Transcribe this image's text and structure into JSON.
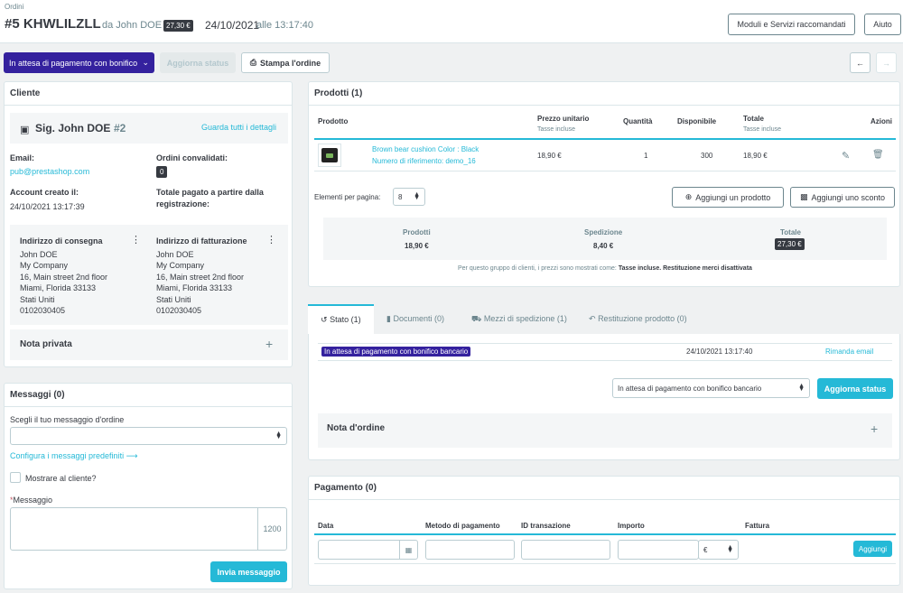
{
  "breadcrumb": "Ordini",
  "header": {
    "number": "#5",
    "reference": "KHWLILZLL",
    "by": "da John DOE",
    "total_badge": "27,30 €",
    "date": "24/10/2021",
    "at": "alle 13:17:40",
    "btn_modules": "Moduli e Servizi raccomandati",
    "btn_help": "Aiuto"
  },
  "toolbar": {
    "status": "In attesa di pagamento con bonifico",
    "update": "Aggiorna status",
    "print": "Stampa l'ordine"
  },
  "customer": {
    "title": "Cliente",
    "name": "Sig. John DOE",
    "id": "#2",
    "see_all": "Guarda tutti i dettagli",
    "email_label": "Email:",
    "email": "pub@prestashop.com",
    "orders_label": "Ordini convalidati:",
    "orders_count": "0",
    "created_label": "Account creato il:",
    "created": "24/10/2021 13:17:39",
    "total_label_1": "Totale pagato a partire dalla",
    "total_label_2": "registrazione:",
    "shipping": {
      "title": "Indirizzo di consegna",
      "lines": [
        "John DOE",
        "My Company",
        "16, Main street 2nd floor",
        "Miami, Florida 33133",
        "Stati Uniti",
        "0102030405"
      ]
    },
    "billing": {
      "title": "Indirizzo di fatturazione",
      "lines": [
        "John DOE",
        "My Company",
        "16, Main street 2nd floor",
        "Miami, Florida 33133",
        "Stati Uniti",
        "0102030405"
      ]
    },
    "private_note": "Nota privata"
  },
  "messages": {
    "title": "Messaggi (0)",
    "choose": "Scegli il tuo messaggio d'ordine",
    "configure": "Configura i messaggi predefiniti",
    "show_customer": "Mostrare al cliente?",
    "message_label": "Messaggio",
    "counter": "1200",
    "send": "Invia messaggio"
  },
  "products": {
    "title": "Prodotti (1)",
    "cols": {
      "product": "Prodotto",
      "unit": "Prezzo unitario",
      "unit_sub": "Tasse incluse",
      "qty": "Quantità",
      "avail": "Disponibile",
      "total": "Totale",
      "total_sub": "Tasse incluse",
      "actions": "Azioni"
    },
    "row": {
      "name": "Brown bear cushion Color : Black",
      "ref": "Numero di riferimento: demo_16",
      "unit": "18,90 €",
      "qty": "1",
      "avail": "300",
      "total": "18,90 €"
    },
    "per_page_label": "Elementi per pagina:",
    "per_page": "8",
    "add_product": "Aggiungi un prodotto",
    "add_discount": "Aggiungi uno sconto",
    "sum": {
      "products_label": "Prodotti",
      "products": "18,90 €",
      "shipping_label": "Spedizione",
      "shipping": "8,40 €",
      "total_label": "Totale",
      "total": "27,30 €"
    },
    "note_pre": "Per questo gruppo di clienti, i prezzi sono mostrati come:",
    "note_bold": "Tasse incluse. Restituzione merci disattivata"
  },
  "tabs": [
    "Stato (1)",
    "Documenti (0)",
    "Mezzi di spedizione (1)",
    "Restituzione prodotto (0)"
  ],
  "status_panel": {
    "badge": "In attesa di pagamento con bonifico bancario",
    "date": "24/10/2021 13:17:40",
    "resend": "Rimanda email",
    "select": "In attesa di pagamento con bonifico bancario",
    "update": "Aggiorna status",
    "order_note": "Nota d'ordine"
  },
  "payment": {
    "title": "Pagamento (0)",
    "cols": [
      "Data",
      "Metodo di pagamento",
      "ID transazione",
      "Importo",
      "Fattura"
    ],
    "currency": "€",
    "add": "Aggiungi"
  },
  "colors": {
    "primary": "#25b9d7",
    "dark": "#363a41",
    "status": "#34219e"
  }
}
